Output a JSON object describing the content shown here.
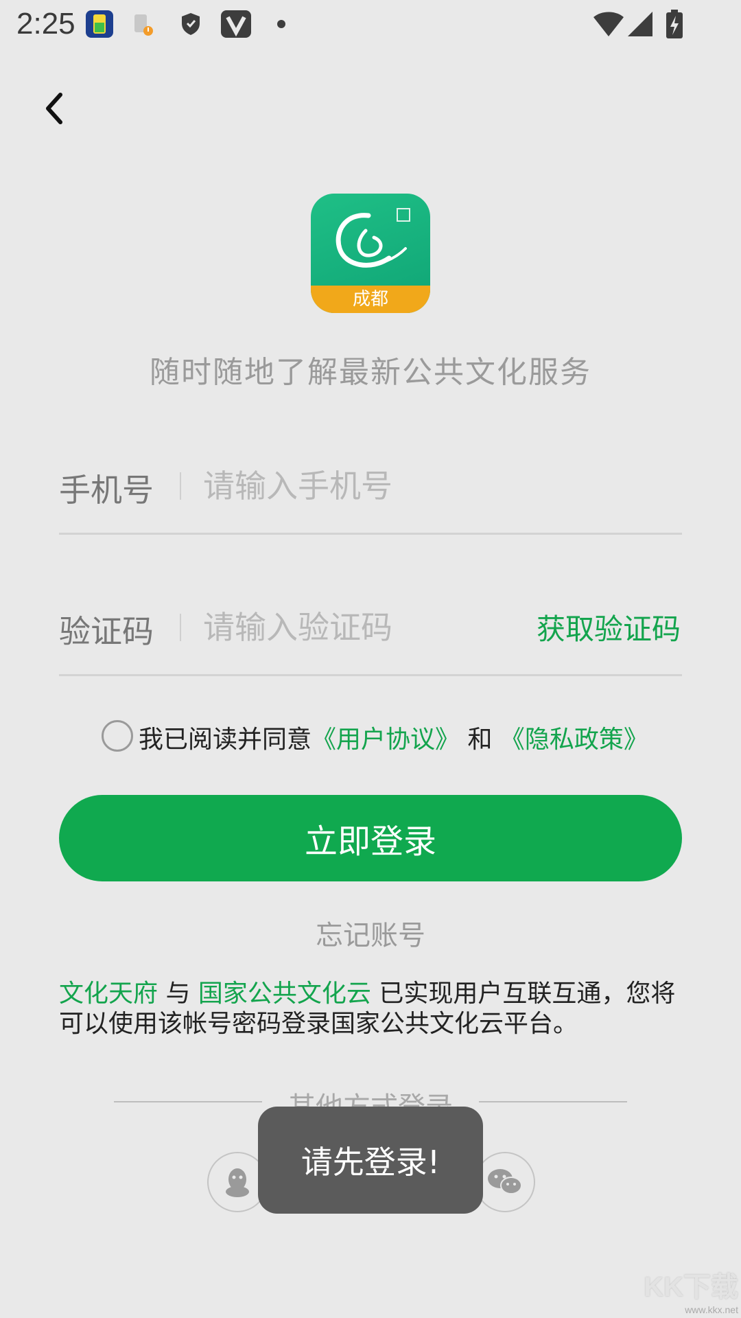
{
  "status_bar": {
    "time": "2:25"
  },
  "header": {
    "back_icon": "chevron-left-icon"
  },
  "logo": {
    "city_text": "成都"
  },
  "tagline": "随时随地了解最新公共文化服务",
  "form": {
    "phone": {
      "label": "手机号",
      "placeholder": "请输入手机号"
    },
    "code": {
      "label": "验证码",
      "placeholder": "请输入验证码",
      "get_code_label": "获取验证码"
    }
  },
  "agreement": {
    "prefix": "我已阅读并同意",
    "user_agreement": "《用户协议》",
    "and": " 和 ",
    "privacy_policy": "《隐私政策》"
  },
  "login_button": "立即登录",
  "forgot_account": "忘记账号",
  "notice": {
    "brand1": "文化天府",
    "with": " 与 ",
    "brand2": "国家公共文化云",
    "text": " 已实现用户互联互通，您将可以使用该帐号密码登录国家公共文化云平台。"
  },
  "other_login": {
    "label": "其他方式登录",
    "qq_icon": "qq-icon",
    "wechat_icon": "wechat-icon"
  },
  "toast": "请先登录!",
  "watermark": {
    "logo": "KK下载",
    "url": "www.kkx.net"
  },
  "colors": {
    "accent": "#13a44d",
    "button": "#10a94f",
    "background": "#e9e9e9"
  }
}
